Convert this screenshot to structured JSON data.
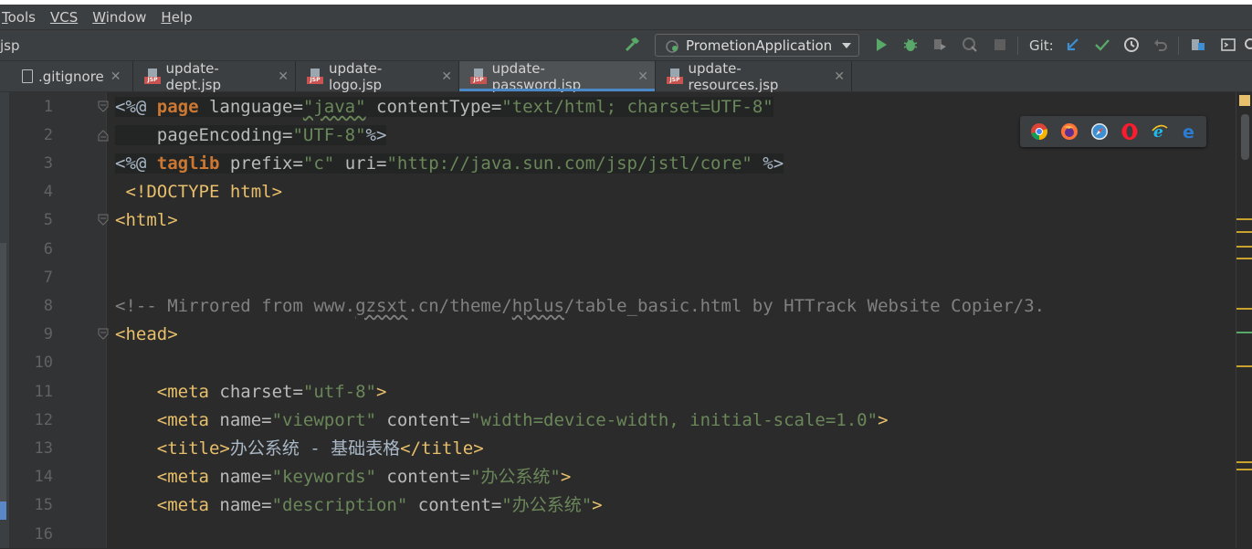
{
  "menu": {
    "items": [
      {
        "first": "T",
        "rest": "ools"
      },
      {
        "first": "",
        "rest": "VCS",
        "underline_all": true
      },
      {
        "first": "W",
        "rest": "indow"
      },
      {
        "first": "H",
        "rest": "elp"
      }
    ]
  },
  "navbar": {
    "breadcrumb": "jsp",
    "run_config": "PrometionApplication",
    "git_label": "Git:"
  },
  "tabs": [
    {
      "label": ".gitignore",
      "icon": "text-file-icon",
      "active": false
    },
    {
      "label": "update-dept.jsp",
      "icon": "jsp-file-icon",
      "active": false
    },
    {
      "label": "update-logo.jsp",
      "icon": "jsp-file-icon",
      "active": false
    },
    {
      "label": "update-password.jsp",
      "icon": "jsp-file-icon",
      "active": true
    },
    {
      "label": "update-resources.jsp",
      "icon": "jsp-file-icon",
      "active": false
    }
  ],
  "editor": {
    "line_numbers": [
      "1",
      "2",
      "3",
      "4",
      "5",
      "6",
      "7",
      "8",
      "9",
      "10",
      "11",
      "12",
      "13",
      "14",
      "15",
      "16"
    ],
    "code": {
      "l1_a": "<%@ ",
      "l1_kw": "page",
      "l1_b": " language=",
      "l1_c": "\"java\"",
      "l1_d": " contentType=",
      "l1_e": "\"text/html; charset=UTF-8\"",
      "l2_a": "    pageEncoding=",
      "l2_b": "\"UTF-8\"",
      "l2_c": "%>",
      "l3_a": "<%@ ",
      "l3_kw": "taglib",
      "l3_b": " prefix=",
      "l3_c": "\"c\"",
      "l3_d": " uri=",
      "l3_e": "\"http://java.sun.com/jsp/jstl/core\"",
      "l3_f": " %>",
      "l4": " <!DOCTYPE html>",
      "l5": "<html>",
      "l8_a": "<!-- Mirrored from www.",
      "l8_b": "gzsxt",
      "l8_c": ".cn/theme/",
      "l8_d": "hplus",
      "l8_e": "/table_basic.html by HTTrack Website Copier/3.",
      "l9": "<head>",
      "l11_a": "    <meta",
      "l11_b": " charset=",
      "l11_c": "\"utf-8\"",
      "l11_d": ">",
      "l12_a": "    <meta",
      "l12_b": " name=",
      "l12_c": "\"viewport\"",
      "l12_d": " content=",
      "l12_e": "\"width=device-width, initial-scale=1.0\"",
      "l12_f": ">",
      "l13_a": "    <title>",
      "l13_b": "办公系统 - 基础表格",
      "l13_c": "</title>",
      "l14_a": "    <meta",
      "l14_b": " name=",
      "l14_c": "\"keywords\"",
      "l14_d": " content=",
      "l14_e": "\"办公系统\"",
      "l14_f": ">",
      "l15_a": "    <meta",
      "l15_b": " name=",
      "l15_c": "\"description\"",
      "l15_d": " content=",
      "l15_e": "\"办公系统\"",
      "l15_f": ">"
    }
  },
  "browsers": [
    "chrome-icon",
    "firefox-icon",
    "safari-icon",
    "opera-icon",
    "internet-explorer-icon",
    "edge-icon"
  ],
  "colors": {
    "background": "#2b2b2b",
    "tag": "#e8bf6a",
    "string": "#6a8759",
    "keyword": "#cc7832",
    "comment": "#808080",
    "accent": "#4a88c7"
  }
}
